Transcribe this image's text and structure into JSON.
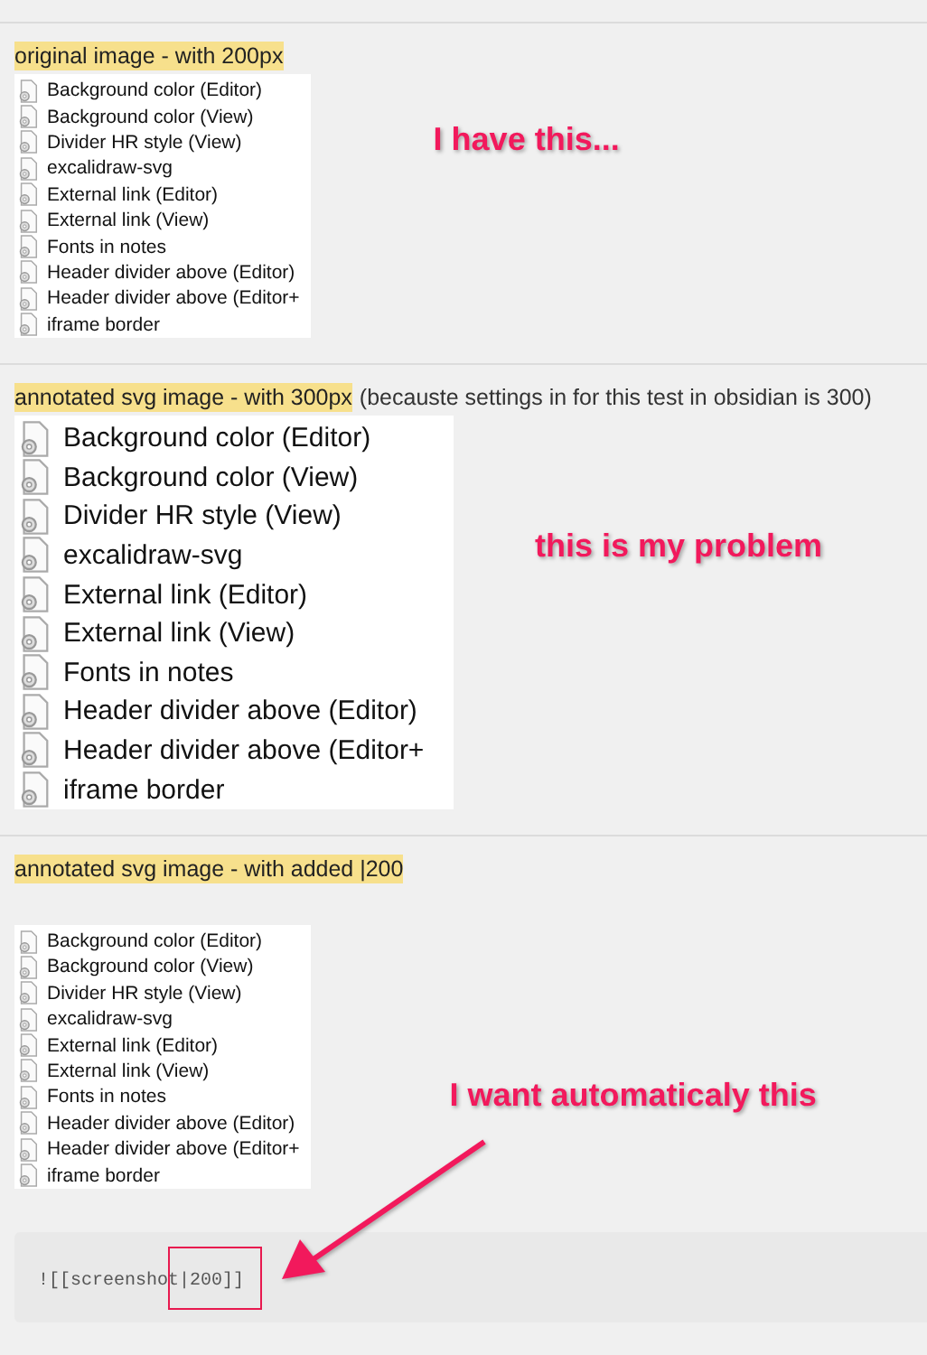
{
  "sections": [
    {
      "heading": "original image - with 200px",
      "kind": "small",
      "annotation": "I have this...",
      "items": [
        "Background color (Editor)",
        "Background color (View)",
        "Divider HR style (View)",
        "excalidraw-svg",
        "External link (Editor)",
        "External link (View)",
        "Fonts in notes",
        "Header divider above (Editor)",
        "Header divider above (Editor+",
        "iframe border"
      ]
    },
    {
      "heading": "annotated svg image - with 300px",
      "heading_note": "(becauste settings in for this test in obsidian is 300)",
      "kind": "large",
      "annotation": "this is my problem",
      "items": [
        "Background color (Editor)",
        "Background color (View)",
        "Divider HR style (View)",
        "excalidraw-svg",
        "External link (Editor)",
        "External link (View)",
        "Fonts in notes",
        "Header divider above (Editor)",
        "Header divider above (Editor+",
        "iframe border"
      ]
    },
    {
      "heading": "annotated svg image - with added |200",
      "kind": "small",
      "annotation": "I want automaticaly this",
      "items": [
        "Background color (Editor)",
        "Background color (View)",
        "Divider HR style (View)",
        "excalidraw-svg",
        "External link (Editor)",
        "External link (View)",
        "Fonts in notes",
        "Header divider above (Editor)",
        "Header divider above (Editor+",
        "iframe border"
      ]
    }
  ],
  "code": {
    "text": "![[screenshot|200]]"
  }
}
